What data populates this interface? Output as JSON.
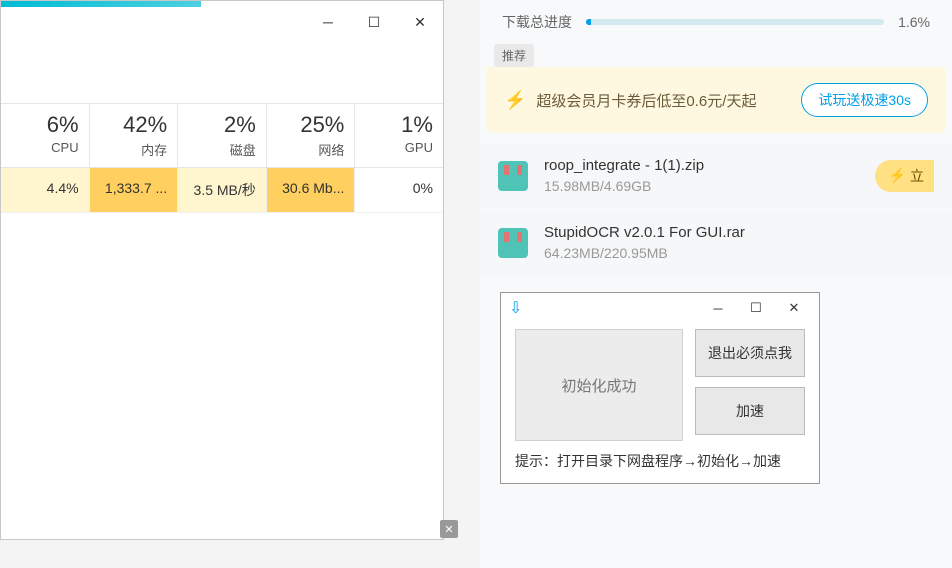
{
  "taskmgr": {
    "columns": [
      {
        "pct": "6%",
        "label": "CPU"
      },
      {
        "pct": "42%",
        "label": "内存"
      },
      {
        "pct": "2%",
        "label": "磁盘"
      },
      {
        "pct": "25%",
        "label": "网络"
      },
      {
        "pct": "1%",
        "label": "GPU"
      }
    ],
    "row": [
      "4.4%",
      "1,333.7 ...",
      "3.5 MB/秒",
      "30.6 Mb...",
      "0%"
    ]
  },
  "download": {
    "progress_label": "下载总进度",
    "progress_pct": "1.6%",
    "progress_fill_pct": "1.6%",
    "promo_tag": "推荐",
    "promo_text": "超级会员月卡券后低至0.6元/天起",
    "try_btn": "试玩送极速30s",
    "items": [
      {
        "name": "roop_integrate - 1(1).zip",
        "size": "15.98MB/4.69GB",
        "action": "立"
      },
      {
        "name": "StupidOCR v2.0.1 For GUI.rar",
        "size": "64.23MB/220.95MB",
        "action": ""
      }
    ]
  },
  "util": {
    "status": "初始化成功",
    "btn_exit": "退出必须点我",
    "btn_accel": "加速",
    "hint": "提示：打开目录下网盘程序→初始化→加速"
  }
}
